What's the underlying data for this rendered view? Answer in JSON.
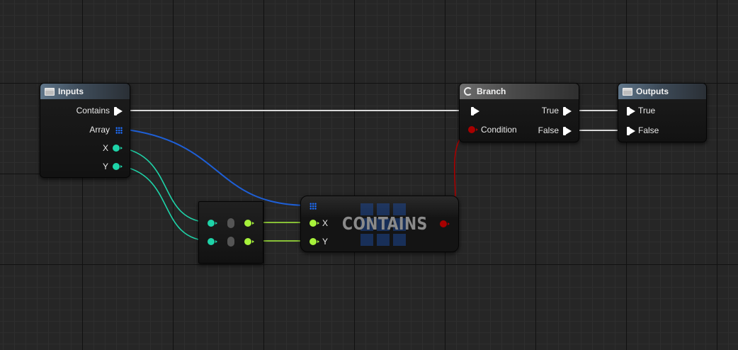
{
  "graph": {
    "inputs_node": {
      "title": "Inputs",
      "icon": "struct-icon",
      "pins": {
        "contains": "Contains",
        "array": "Array",
        "x": "X",
        "y": "Y"
      }
    },
    "branch_node": {
      "title": "Branch",
      "icon": "branch-icon",
      "pins": {
        "condition": "Condition",
        "true": "True",
        "false": "False"
      }
    },
    "outputs_node": {
      "title": "Outputs",
      "icon": "struct-icon",
      "pins": {
        "true": "True",
        "false": "False"
      }
    },
    "contains_node": {
      "title": "CONTAINS",
      "pins": {
        "x": "X",
        "y": "Y"
      }
    },
    "colors": {
      "exec_wire": "#ffffff",
      "array_wire": "#1e5fd6",
      "float_wire": "#1ed3a8",
      "vector_wire": "#a7f23b",
      "bool_wire": "#a80000",
      "grid_bg": "#262626"
    }
  }
}
